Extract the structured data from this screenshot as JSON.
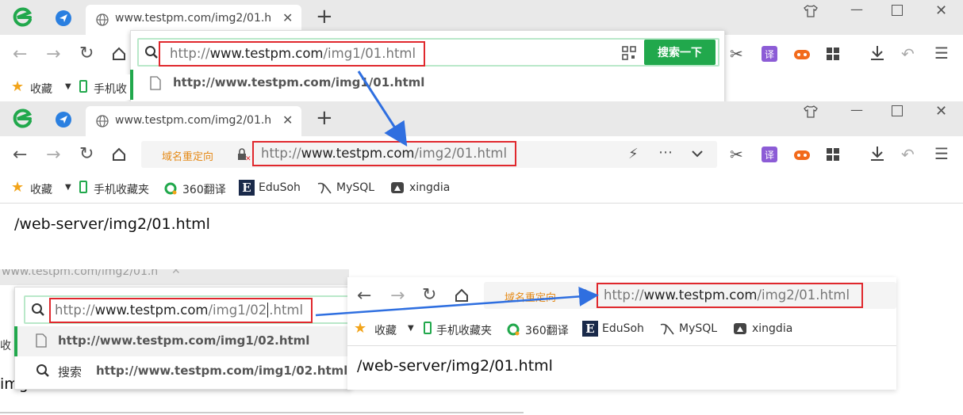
{
  "colors": {
    "accent": "#21a84c",
    "annotation_red": "#e0282d",
    "arrow_blue": "#2f6fe0",
    "redirect_orange": "#e58a18"
  },
  "top_browser": {
    "tab_title": "www.testpm.com/img2/01.h",
    "address_typed": {
      "scheme": "http://",
      "host": "www.testpm.com",
      "path": "/img1/01.html"
    },
    "search_button": "搜索一下",
    "suggestion": "http://www.testpm.com/img1/01.html",
    "bookmark_fav": "收藏",
    "bookmark_mobile_partial": "手机收"
  },
  "middle_browser": {
    "tab_title": "www.testpm.com/img2/01.h",
    "redirect_label": "域名重定向",
    "address": {
      "scheme": "http://",
      "host": "www.testpm.com",
      "path": "/img2/01.html"
    },
    "bookmarks": [
      "收藏",
      "手机收藏夹",
      "360翻译",
      "EduSoh",
      "MySQL",
      "xingdia"
    ],
    "page_content": "/web-server/img2/01.html"
  },
  "bottom_left_browser": {
    "tab_title_partial": "www.testpm.com/img2/01.h",
    "address_typed": {
      "scheme": "http://",
      "host": "www.testpm.com",
      "path_a": "/img1/02",
      "path_b": ".html"
    },
    "suggestion_1": "http://www.testpm.com/img1/02.html",
    "search_label": "搜索",
    "suggestion_2": "http://www.testpm.com/img1/02.html",
    "left_fragment_1": "收",
    "left_fragment_2": "img"
  },
  "bottom_right_browser": {
    "redirect_label": "域名重定向",
    "address": {
      "scheme": "http://",
      "host": "www.testpm.com",
      "path": "/img2/01.html"
    },
    "bookmarks": [
      "收藏",
      "手机收藏夹",
      "360翻译",
      "EduSoh",
      "MySQL",
      "xingdia"
    ],
    "page_content": "/web-server/img2/01.html"
  }
}
